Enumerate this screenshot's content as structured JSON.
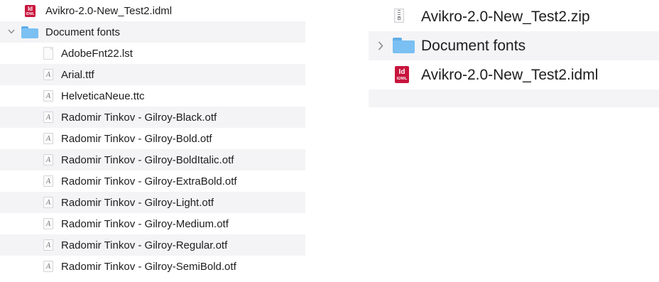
{
  "colors": {
    "indesign_bg": "#c8153d",
    "folder_tab": "#62aeea",
    "folder_body": "#7ac0f2",
    "row_alt": "#f4f4f6"
  },
  "left": {
    "rows": [
      {
        "label": "Avikro-2.0-New_Test2.idml",
        "icon": "indesign-file-icon",
        "icon_text": "Id",
        "icon_sub": "IDML"
      },
      {
        "label": "Document fonts",
        "icon": "folder-icon",
        "expanded": true
      },
      {
        "label": "AdobeFnt22.lst",
        "icon": "document-icon"
      },
      {
        "label": "Arial.ttf",
        "icon": "font-file-icon"
      },
      {
        "label": "HelveticaNeue.ttc",
        "icon": "font-file-icon"
      },
      {
        "label": "Radomir Tinkov - Gilroy-Black.otf",
        "icon": "font-file-icon"
      },
      {
        "label": "Radomir Tinkov - Gilroy-Bold.otf",
        "icon": "font-file-icon"
      },
      {
        "label": "Radomir Tinkov - Gilroy-BoldItalic.otf",
        "icon": "font-file-icon"
      },
      {
        "label": "Radomir Tinkov - Gilroy-ExtraBold.otf",
        "icon": "font-file-icon"
      },
      {
        "label": "Radomir Tinkov - Gilroy-Light.otf",
        "icon": "font-file-icon"
      },
      {
        "label": "Radomir Tinkov - Gilroy-Medium.otf",
        "icon": "font-file-icon"
      },
      {
        "label": "Radomir Tinkov - Gilroy-Regular.otf",
        "icon": "font-file-icon"
      },
      {
        "label": "Radomir Tinkov - Gilroy-SemiBold.otf",
        "icon": "font-file-icon"
      }
    ],
    "font_glyph": "A",
    "expanded_chevron": "⌄"
  },
  "right": {
    "rows": [
      {
        "label": "Avikro-2.0-New_Test2.zip",
        "icon": "zip-archive-icon"
      },
      {
        "label": "Document fonts",
        "icon": "folder-icon",
        "expanded": false
      },
      {
        "label": "Avikro-2.0-New_Test2.idml",
        "icon": "indesign-file-icon",
        "icon_text": "Id",
        "icon_sub": "IDML"
      }
    ],
    "collapsed_chevron": "›"
  }
}
